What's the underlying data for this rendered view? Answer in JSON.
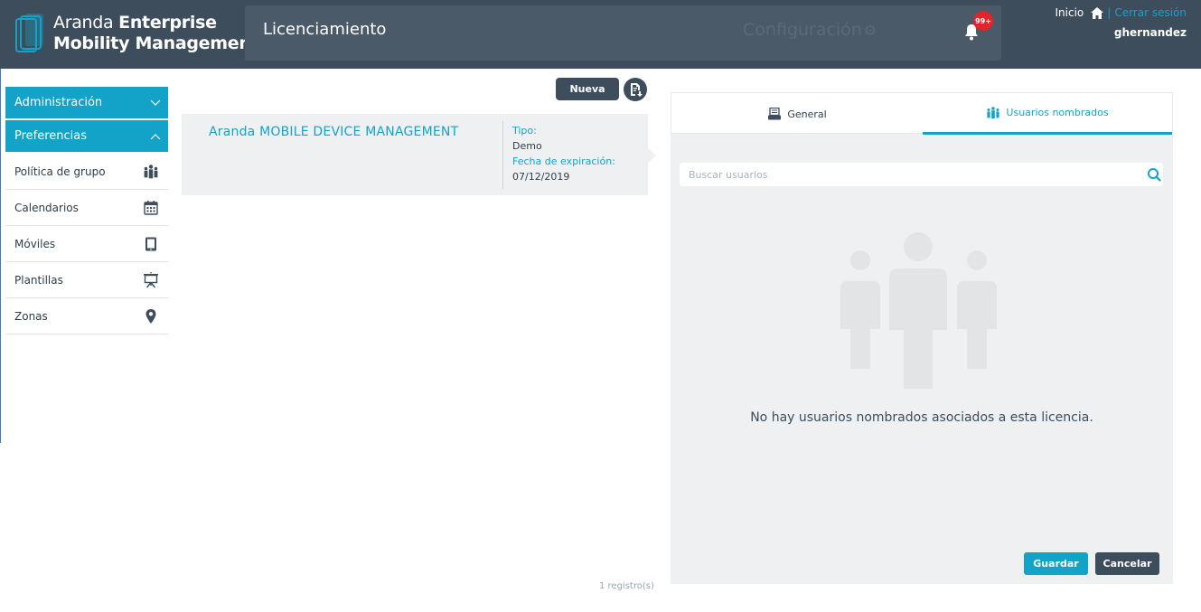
{
  "header": {
    "brand_light": "Aranda ",
    "brand_bold_1": "Enterprise",
    "brand_bold_2": "Mobility Management",
    "page_title": "Licenciamiento",
    "config_label": "Configuración",
    "notification_badge": "99+",
    "home_link": "Inicio",
    "separator": "|",
    "logout_link": "Cerrar sesión",
    "username": "ghernandez"
  },
  "sidebar": {
    "sections": [
      {
        "label": "Administración",
        "expanded": false
      },
      {
        "label": "Preferencias",
        "expanded": true
      }
    ],
    "items": [
      {
        "label": "Política de grupo",
        "icon": "group-icon"
      },
      {
        "label": "Calendarios",
        "icon": "calendar-icon"
      },
      {
        "label": "Móviles",
        "icon": "mobile-icon"
      },
      {
        "label": "Plantillas",
        "icon": "presentation-icon"
      },
      {
        "label": "Zonas",
        "icon": "location-pin-icon"
      }
    ]
  },
  "licenses": {
    "new_button": "Nueva",
    "items": [
      {
        "name": "Aranda MOBILE DEVICE MANAGEMENT",
        "type_label": "Tipo:",
        "type_value": "Demo",
        "expiry_label": "Fecha de expiración:",
        "expiry_value": "07/12/2019"
      }
    ],
    "count_text": "1 registro(s)"
  },
  "detail": {
    "tabs": [
      {
        "label": "General",
        "active": false
      },
      {
        "label": "Usuarios nombrados",
        "active": true
      }
    ],
    "search_placeholder": "Buscar usuarios",
    "empty_message": "No hay usuarios nombrados asociados a esta licencia.",
    "save_button": "Guardar",
    "cancel_button": "Cancelar"
  },
  "colors": {
    "accent": "#13a3c9",
    "header_bg": "#3d4d5b",
    "badge": "#e0262a"
  }
}
